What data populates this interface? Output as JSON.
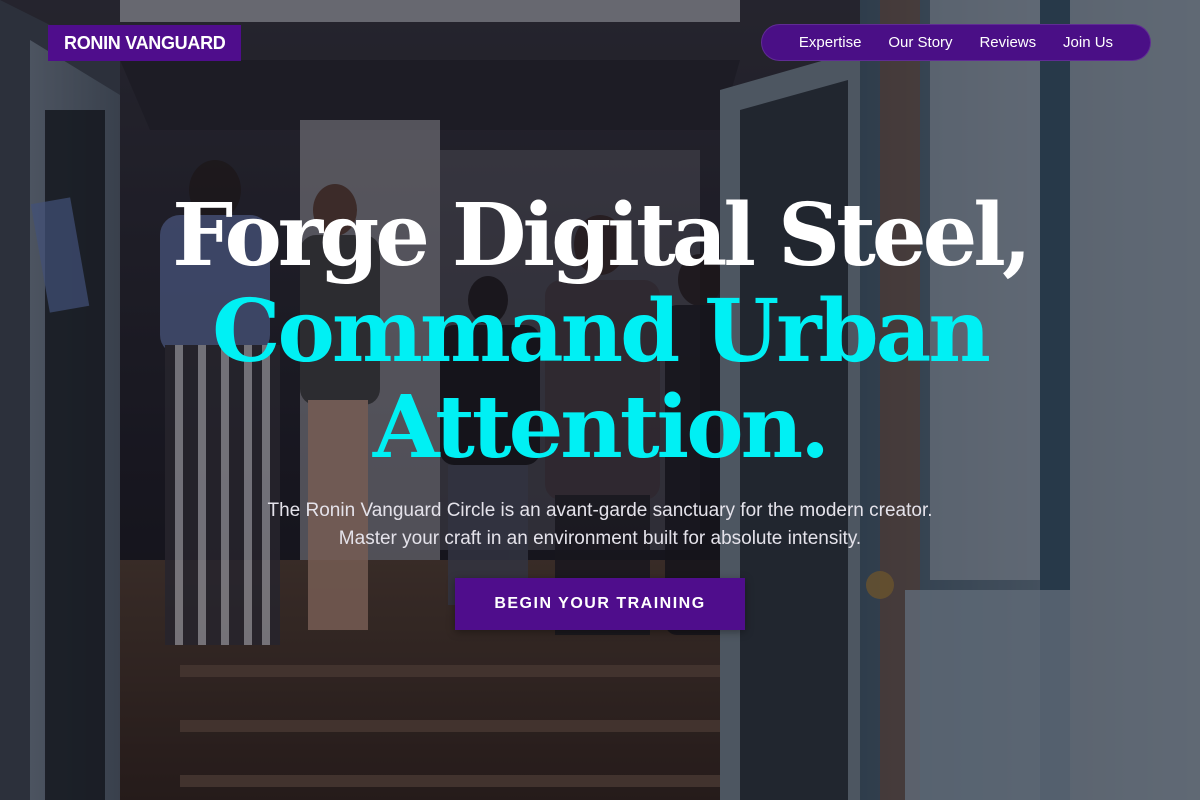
{
  "brand": {
    "name": "RONIN VANGUARD"
  },
  "nav": {
    "items": [
      {
        "label": "Expertise"
      },
      {
        "label": "Our Story"
      },
      {
        "label": "Reviews"
      },
      {
        "label": "Join Us"
      }
    ]
  },
  "hero": {
    "headline_line1": "Forge Digital Steel,",
    "headline_line2": "Command Urban",
    "headline_line3": "Attention.",
    "subtitle": "The Ronin Vanguard Circle is an avant-garde sanctuary for the modern creator. Master your craft in an environment built for absolute intensity.",
    "cta_label": "BEGIN YOUR TRAINING"
  },
  "colors": {
    "accent_purple": "#4f0d8c",
    "headline_cyan": "#00f0f4",
    "headline_white": "#ffffff"
  }
}
